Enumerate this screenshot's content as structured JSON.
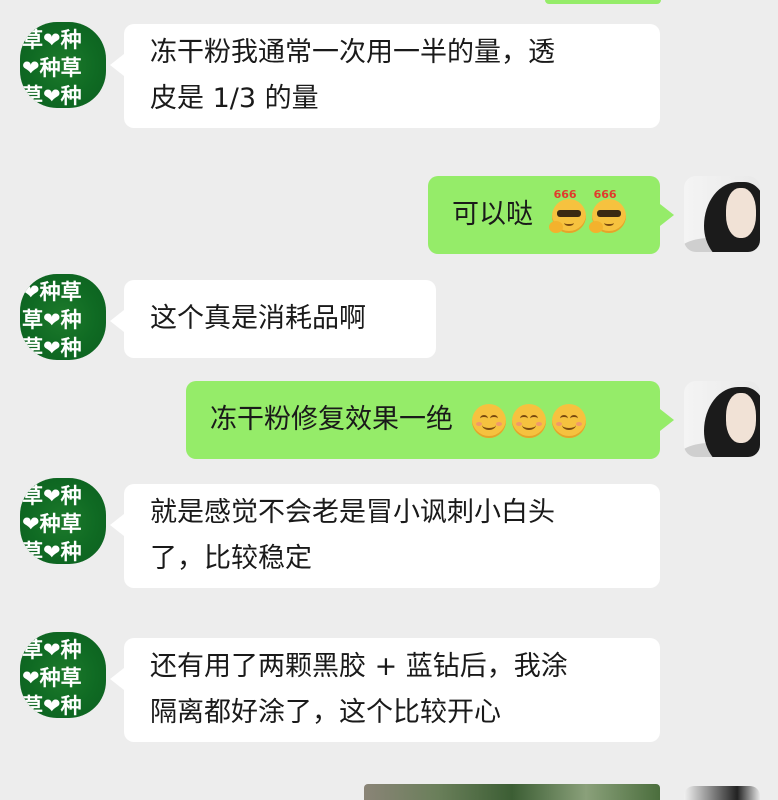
{
  "messages": [
    {
      "from": "contact",
      "text_lines": [
        "冻干粉我通常一次用一半的量，透",
        "皮是 1/3 的量"
      ]
    },
    {
      "from": "self",
      "text": "可以哒",
      "emoji": [
        "666-emoji",
        "666-emoji"
      ]
    },
    {
      "from": "contact",
      "text_lines": [
        "这个真是消耗品啊"
      ]
    },
    {
      "from": "self",
      "text": "冻干粉修复效果一绝",
      "emoji": [
        "smile-emoji",
        "smile-emoji",
        "smile-emoji"
      ]
    },
    {
      "from": "contact",
      "text_lines": [
        "就是感觉不会老是冒小讽刺小白头",
        "了，比较稳定"
      ]
    },
    {
      "from": "contact",
      "text_lines": [
        "还有用了两颗黑胶 + 蓝钻后，我涂",
        "隔离都好涂了，这个比较开心"
      ]
    }
  ],
  "contact_avatar": {
    "lines": [
      "草❤种",
      "❤种草",
      "草❤种"
    ]
  },
  "emoji_tag": "666",
  "colors": {
    "background": "#ededed",
    "incoming_bubble": "#ffffff",
    "outgoing_bubble": "#95ec69",
    "avatar_green": "#0f6a23"
  },
  "icons": {
    "contact_avatar": "grass-heart-avatar",
    "self_avatar": "woman-photo-avatar"
  }
}
